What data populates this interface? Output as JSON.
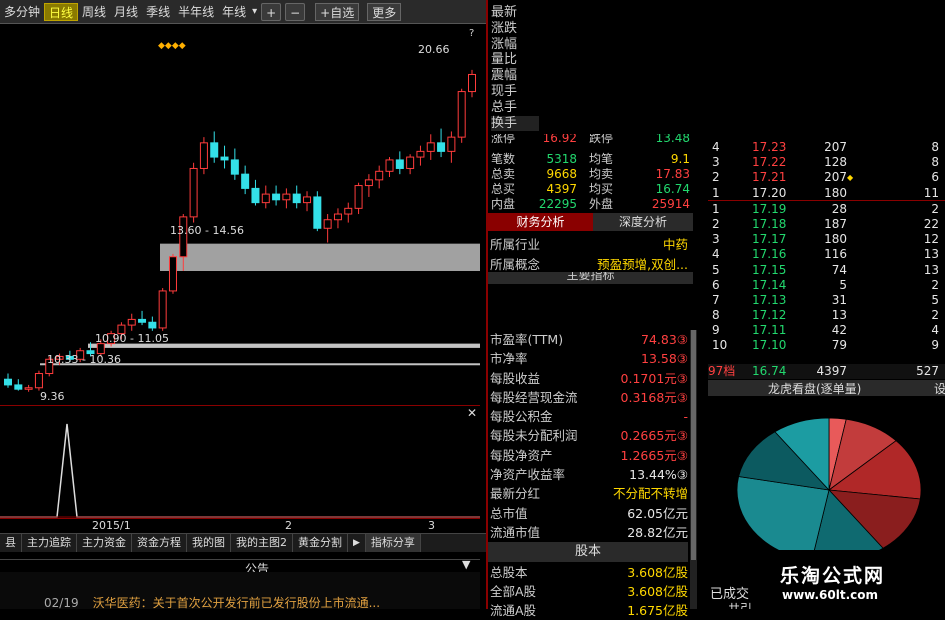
{
  "toolbar": {
    "items": [
      "多分钟",
      "日线",
      "周线",
      "月线",
      "季线",
      "半年线",
      "年线"
    ],
    "year_arrow": "▾",
    "plus": "+",
    "minus": "−",
    "add_watch": "+自选",
    "more": "更多"
  },
  "chart": {
    "price_labels": {
      "high": "20.66",
      "zone1": "13.60 - 14.56",
      "zone2": "10.90 - 11.05",
      "zone3": "10.33 - 10.36",
      "low": "9.36"
    },
    "markers": "◆◆◆◆",
    "question": "?",
    "x_axis": {
      "label1": "2015/1",
      "label2": "2",
      "label3": "3"
    }
  },
  "chart_data": {
    "type": "candlestick",
    "series": [
      {
        "o": 9.8,
        "h": 10.0,
        "l": 9.5,
        "c": 9.6
      },
      {
        "o": 9.6,
        "h": 9.8,
        "l": 9.4,
        "c": 9.45
      },
      {
        "o": 9.45,
        "h": 9.6,
        "l": 9.36,
        "c": 9.5
      },
      {
        "o": 9.5,
        "h": 10.1,
        "l": 9.4,
        "c": 10.0
      },
      {
        "o": 10.0,
        "h": 10.6,
        "l": 9.9,
        "c": 10.5
      },
      {
        "o": 10.5,
        "h": 10.7,
        "l": 10.3,
        "c": 10.6
      },
      {
        "o": 10.6,
        "h": 10.8,
        "l": 10.4,
        "c": 10.5
      },
      {
        "o": 10.5,
        "h": 10.9,
        "l": 10.4,
        "c": 10.8
      },
      {
        "o": 10.8,
        "h": 11.1,
        "l": 10.6,
        "c": 10.7
      },
      {
        "o": 10.7,
        "h": 11.2,
        "l": 10.6,
        "c": 11.05
      },
      {
        "o": 11.05,
        "h": 11.5,
        "l": 10.95,
        "c": 11.4
      },
      {
        "o": 11.4,
        "h": 11.8,
        "l": 11.2,
        "c": 11.7
      },
      {
        "o": 11.7,
        "h": 12.1,
        "l": 11.5,
        "c": 11.9
      },
      {
        "o": 11.9,
        "h": 12.2,
        "l": 11.7,
        "c": 11.8
      },
      {
        "o": 11.8,
        "h": 12.0,
        "l": 11.5,
        "c": 11.6
      },
      {
        "o": 11.6,
        "h": 13.0,
        "l": 11.5,
        "c": 12.9
      },
      {
        "o": 12.9,
        "h": 14.2,
        "l": 12.8,
        "c": 14.1
      },
      {
        "o": 14.1,
        "h": 15.6,
        "l": 13.6,
        "c": 15.5
      },
      {
        "o": 15.5,
        "h": 17.4,
        "l": 15.3,
        "c": 17.2
      },
      {
        "o": 17.2,
        "h": 18.3,
        "l": 17.0,
        "c": 18.1
      },
      {
        "o": 18.1,
        "h": 18.5,
        "l": 17.4,
        "c": 17.6
      },
      {
        "o": 17.6,
        "h": 18.0,
        "l": 17.2,
        "c": 17.5
      },
      {
        "o": 17.5,
        "h": 17.9,
        "l": 16.8,
        "c": 17.0
      },
      {
        "o": 17.0,
        "h": 17.3,
        "l": 16.3,
        "c": 16.5
      },
      {
        "o": 16.5,
        "h": 16.8,
        "l": 15.9,
        "c": 16.0
      },
      {
        "o": 16.0,
        "h": 16.6,
        "l": 15.8,
        "c": 16.3
      },
      {
        "o": 16.3,
        "h": 16.6,
        "l": 15.9,
        "c": 16.1
      },
      {
        "o": 16.1,
        "h": 16.5,
        "l": 15.8,
        "c": 16.3
      },
      {
        "o": 16.3,
        "h": 16.6,
        "l": 15.8,
        "c": 16.0
      },
      {
        "o": 16.0,
        "h": 16.4,
        "l": 15.7,
        "c": 16.2
      },
      {
        "o": 16.2,
        "h": 16.4,
        "l": 15.0,
        "c": 15.1
      },
      {
        "o": 15.1,
        "h": 15.6,
        "l": 14.6,
        "c": 15.4
      },
      {
        "o": 15.4,
        "h": 15.8,
        "l": 15.1,
        "c": 15.6
      },
      {
        "o": 15.6,
        "h": 16.0,
        "l": 15.3,
        "c": 15.8
      },
      {
        "o": 15.8,
        "h": 16.7,
        "l": 15.6,
        "c": 16.6
      },
      {
        "o": 16.6,
        "h": 17.0,
        "l": 16.2,
        "c": 16.8
      },
      {
        "o": 16.8,
        "h": 17.3,
        "l": 16.5,
        "c": 17.1
      },
      {
        "o": 17.1,
        "h": 17.6,
        "l": 16.9,
        "c": 17.5
      },
      {
        "o": 17.5,
        "h": 17.8,
        "l": 17.0,
        "c": 17.2
      },
      {
        "o": 17.2,
        "h": 17.7,
        "l": 17.0,
        "c": 17.6
      },
      {
        "o": 17.6,
        "h": 18.0,
        "l": 17.3,
        "c": 17.8
      },
      {
        "o": 17.8,
        "h": 18.4,
        "l": 17.5,
        "c": 18.1
      },
      {
        "o": 18.1,
        "h": 18.6,
        "l": 17.6,
        "c": 17.8
      },
      {
        "o": 17.8,
        "h": 18.5,
        "l": 17.4,
        "c": 18.3
      },
      {
        "o": 18.3,
        "h": 20.0,
        "l": 18.1,
        "c": 19.9
      },
      {
        "o": 19.9,
        "h": 20.66,
        "l": 19.7,
        "c": 20.5
      }
    ],
    "ylim": [
      9.0,
      21.5
    ],
    "zones": [
      [
        13.6,
        14.56
      ],
      [
        10.9,
        11.05
      ],
      [
        10.33,
        10.36
      ]
    ]
  },
  "side_fields": [
    "最新",
    "涨跌",
    "涨幅",
    "量比",
    "震幅",
    "现手",
    "总手",
    "换手"
  ],
  "quote": {
    "limit_row": {
      "label": "涨停",
      "val": "16.92",
      "label2": "跌停",
      "val2": "13.48"
    },
    "rows": [
      {
        "l1": "笔数",
        "v1": "5318",
        "l2": "均笔",
        "v2": "9.1",
        "c1": "grn",
        "c2": "yel"
      },
      {
        "l1": "总卖",
        "v1": "9668",
        "l2": "均卖",
        "v2": "17.83",
        "c1": "yel",
        "c2": "red"
      },
      {
        "l1": "总买",
        "v1": "4397",
        "l2": "均买",
        "v2": "16.74",
        "c1": "yel",
        "c2": "grn"
      },
      {
        "l1": "内盘",
        "v1": "22295",
        "l2": "外盘",
        "v2": "25914",
        "c1": "grn",
        "c2": "red"
      }
    ]
  },
  "fin_tabs": {
    "a": "财务分析",
    "b": "深度分析"
  },
  "industry": {
    "label": "所属行业",
    "value": "中药"
  },
  "concept": {
    "label": "所属概念",
    "value": "预盈预增,双创..."
  },
  "main_index": "主要指标",
  "fin_rows": [
    {
      "l": "市盈率(TTM)",
      "v": "74.83③",
      "c": "red"
    },
    {
      "l": "市净率",
      "v": "13.58③",
      "c": "red"
    },
    {
      "l": "每股收益",
      "v": "0.1701元③",
      "c": "red"
    },
    {
      "l": "每股经营现金流",
      "v": "0.3168元③",
      "c": "red"
    },
    {
      "l": "每股公积金",
      "v": "-",
      "c": "red"
    },
    {
      "l": "每股未分配利润",
      "v": "0.2665元③",
      "c": "red"
    },
    {
      "l": "每股净资产",
      "v": "1.2665元③",
      "c": "red"
    },
    {
      "l": "净资产收益率",
      "v": "13.44%③",
      "c": "wht"
    },
    {
      "l": "最新分红",
      "v": "不分配不转增",
      "c": "yel"
    },
    {
      "l": "总市值",
      "v": "62.05亿元",
      "c": "wht"
    },
    {
      "l": "流通市值",
      "v": "28.82亿元",
      "c": "wht"
    }
  ],
  "equity_header": "股本",
  "equity_rows": [
    {
      "l": "总股本",
      "v": "3.608亿股"
    },
    {
      "l": "全部A股",
      "v": "3.608亿股"
    },
    {
      "l": "流通A股",
      "v": "1.675亿股"
    }
  ],
  "orderbook": [
    {
      "i": "4",
      "p": "17.23",
      "v": "207",
      "n": "8",
      "pc": "red",
      "mark": ""
    },
    {
      "i": "3",
      "p": "17.22",
      "v": "128",
      "n": "8",
      "pc": "red",
      "mark": ""
    },
    {
      "i": "2",
      "p": "17.21",
      "v": "207",
      "n": "6",
      "pc": "red",
      "mark": "◆"
    },
    {
      "i": "1",
      "p": "17.20",
      "v": "180",
      "n": "11",
      "pc": "wht",
      "mark": ""
    },
    {
      "i": "1",
      "p": "17.19",
      "v": "28",
      "n": "2",
      "pc": "grn",
      "mark": ""
    },
    {
      "i": "2",
      "p": "17.18",
      "v": "187",
      "n": "22",
      "pc": "grn",
      "mark": ""
    },
    {
      "i": "3",
      "p": "17.17",
      "v": "180",
      "n": "12",
      "pc": "grn",
      "mark": ""
    },
    {
      "i": "4",
      "p": "17.16",
      "v": "116",
      "n": "13",
      "pc": "grn",
      "mark": ""
    },
    {
      "i": "5",
      "p": "17.15",
      "v": "74",
      "n": "13",
      "pc": "grn",
      "mark": ""
    },
    {
      "i": "6",
      "p": "17.14",
      "v": "5",
      "n": "2",
      "pc": "grn",
      "mark": ""
    },
    {
      "i": "7",
      "p": "17.13",
      "v": "31",
      "n": "5",
      "pc": "grn",
      "mark": ""
    },
    {
      "i": "8",
      "p": "17.12",
      "v": "13",
      "n": "2",
      "pc": "grn",
      "mark": ""
    },
    {
      "i": "9",
      "p": "17.11",
      "v": "42",
      "n": "4",
      "pc": "grn",
      "mark": ""
    },
    {
      "i": "10",
      "p": "17.10",
      "v": "79",
      "n": "9",
      "pc": "grn",
      "mark": ""
    }
  ],
  "ob_total": {
    "i": "97档",
    "p": "16.74",
    "v": "4397",
    "n": "527"
  },
  "dragon_tiger": {
    "label": "龙虎看盘(逐单量)",
    "cut": "设"
  },
  "pie_data": [
    {
      "name": "s1",
      "value": 3,
      "color": "#e85a5a"
    },
    {
      "name": "s2",
      "value": 10,
      "color": "#c23c3c"
    },
    {
      "name": "s3",
      "value": 14,
      "color": "#b02828"
    },
    {
      "name": "s4",
      "value": 13,
      "color": "#8a1e1e"
    },
    {
      "name": "s5",
      "value": 13,
      "color": "#0f6a70"
    },
    {
      "name": "s6",
      "value": 25,
      "color": "#1a8a90"
    },
    {
      "name": "s7",
      "value": 12,
      "color": "#0c5a60"
    },
    {
      "name": "s8",
      "value": 10,
      "color": "#1c9ca2"
    }
  ],
  "traded": "已成交",
  "traded2": "共引",
  "sub_tabs": [
    "主力追踪",
    "主力资金",
    "资金方程",
    "我的图",
    "我的主图2",
    "黄金分割"
  ],
  "sub_tab_first": "县",
  "sub_tab_share": "指标分享",
  "announce": {
    "title": "公告",
    "date": "02/19",
    "text": "沃华医药：关于首次公开发行前已发行股份上市流通..."
  },
  "watermark": {
    "title": "乐淘公式网",
    "url": "www.60lt.com"
  }
}
